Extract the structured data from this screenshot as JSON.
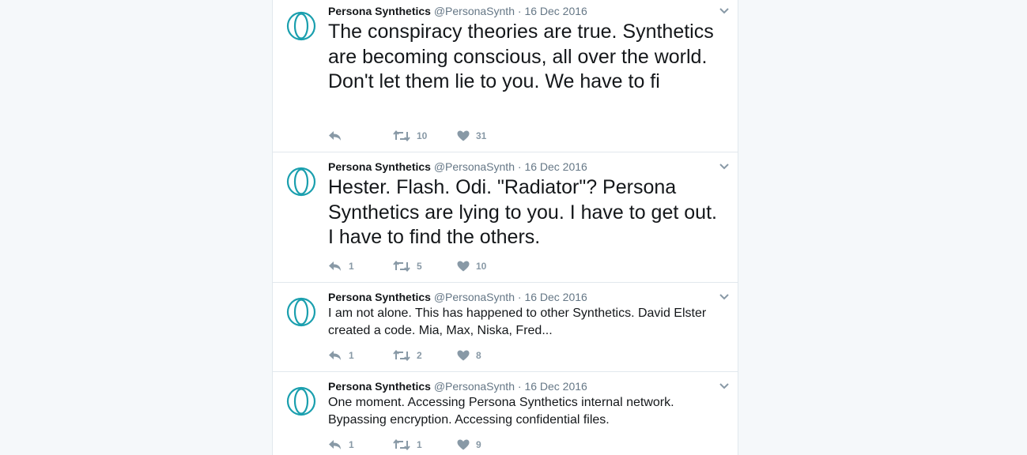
{
  "colors": {
    "accent": "#1a9fae",
    "text": "#14171a",
    "muted": "#657786",
    "icon": "#8899a6"
  },
  "tweets": [
    {
      "name": "Persona Synthetics",
      "handle": "@PersonaSynth",
      "sep": "·",
      "date": "16 Dec 2016",
      "text": "The conspiracy theories are true. Synthetics are becoming conscious, all over the world. Don't let them lie to you. We have to fi",
      "replies": "",
      "retweets": "10",
      "likes": "31"
    },
    {
      "name": "Persona Synthetics",
      "handle": "@PersonaSynth",
      "sep": "·",
      "date": "16 Dec 2016",
      "text": "Hester. Flash. Odi. \"Radiator\"? Persona Synthetics are lying to you. I have to get out. I have to find the others.",
      "replies": "1",
      "retweets": "5",
      "likes": "10"
    },
    {
      "name": "Persona Synthetics",
      "handle": "@PersonaSynth",
      "sep": "·",
      "date": "16 Dec 2016",
      "text": "I am not alone. This has happened to other Synthetics. David Elster created a code. Mia, Max, Niska, Fred...",
      "replies": "1",
      "retweets": "2",
      "likes": "8"
    },
    {
      "name": "Persona Synthetics",
      "handle": "@PersonaSynth",
      "sep": "·",
      "date": "16 Dec 2016",
      "text": "One moment. Accessing Persona Synthetics internal network. Bypassing encryption. Accessing confidential files.",
      "replies": "1",
      "retweets": "1",
      "likes": "9"
    }
  ]
}
